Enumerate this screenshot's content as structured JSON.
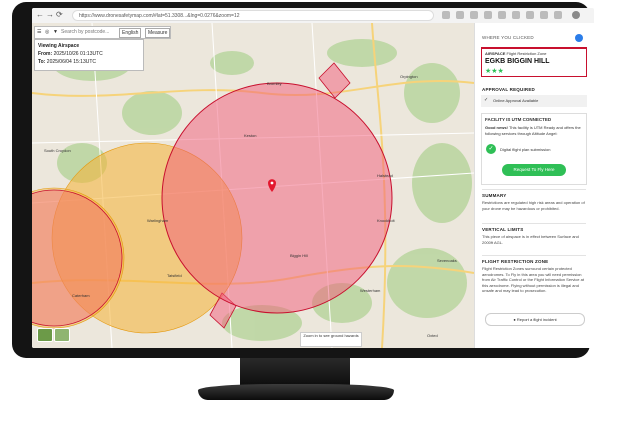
{
  "browser": {
    "url": "https://www.dronesafetymap.com/#lat=51.3308...&lng=0.0276&zoom=12"
  },
  "map": {
    "search_placeholder": "Search by postcode...",
    "language": "English",
    "measure_label": "Measure",
    "viewing_title": "Viewing Airspace",
    "from_label": "From:",
    "from_value": "2025/10/26 01:13UTC",
    "to_label": "To:",
    "to_value": "2025/06/04 15:13UTC",
    "zoom_hint": "Zoom in to see ground hazards",
    "places": [
      {
        "id": "orpington",
        "name": "Orpington"
      },
      {
        "id": "bromley",
        "name": "Bromley"
      },
      {
        "id": "biggin",
        "name": "Biggin Hill"
      },
      {
        "id": "westerham",
        "name": "Westerham"
      },
      {
        "id": "warlingham",
        "name": "Warlingham"
      },
      {
        "id": "caterham",
        "name": "Caterham"
      },
      {
        "id": "oxted",
        "name": "Oxted"
      },
      {
        "id": "croydon",
        "name": "South Croydon"
      },
      {
        "id": "halstead",
        "name": "Halstead"
      },
      {
        "id": "knockholt",
        "name": "Knockholt"
      },
      {
        "id": "sevenoaks",
        "name": "Sevenoaks"
      },
      {
        "id": "tatsfield",
        "name": "Tatsfield"
      },
      {
        "id": "keston",
        "name": "Keston"
      }
    ]
  },
  "panel": {
    "where_clicked": "WHERE YOU CLICKED",
    "airspace_label": "AIRSPACE",
    "airspace_type": "Flight Restriction Zone",
    "airspace_name": "EGKB BIGGIN HILL",
    "rating": "★★★",
    "approval_required": "APPROVAL REQUIRED",
    "online_approval": "Online Approval Available",
    "utm_heading": "FACILITY IS UTM CONNECTED",
    "utm_good_news": "Good news!",
    "utm_text": "This facility is UTM Ready and offers the following services through Altitude Angel:",
    "digital_submission": "Digital flight plan submission",
    "request_button": "Request To Fly Here",
    "summary_heading": "SUMMARY",
    "summary_text": "Restrictions are regulated high risk areas and operation of your drone may be hazardous or prohibited.",
    "vertical_heading": "VERTICAL LIMITS",
    "vertical_text": "This piece of airspace is in effect between Surface and 2000ft AGL.",
    "frz_heading": "FLIGHT RESTRICTION ZONE",
    "frz_text": "Flight Restriction Zones surround certain protected aerodromes. To Fly in this area you will need permission from Air Traffic Control or the Flight Information Service at this aerodrome. Flying without permission is illegal and unsafe and may lead to prosecution.",
    "report_button": "Report a flight incident"
  },
  "colors": {
    "frz_fill": "#f25c7a",
    "frz_stroke": "#c8102e",
    "yellow_zone": "#f5b335",
    "button_green": "#2fbf56"
  }
}
